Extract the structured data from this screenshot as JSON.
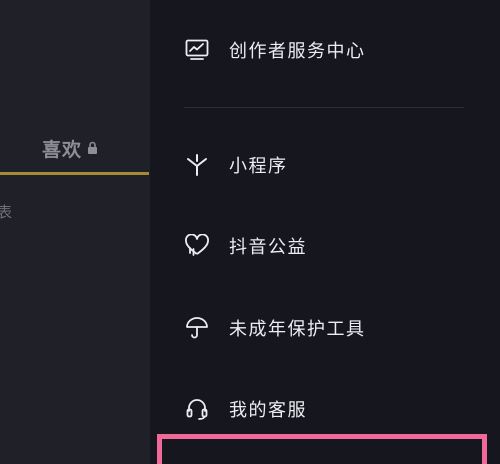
{
  "left_panel": {
    "likes_tab_label": "喜欢",
    "fragment_text": "表"
  },
  "drawer": {
    "items": [
      {
        "label": "创作者服务中心",
        "icon": "creator-chart-icon"
      },
      {
        "label": "小程序",
        "icon": "mini-program-icon"
      },
      {
        "label": "抖音公益",
        "icon": "charity-heart-icon"
      },
      {
        "label": "未成年保护工具",
        "icon": "umbrella-icon"
      },
      {
        "label": "我的客服",
        "icon": "headset-icon"
      }
    ]
  },
  "colors": {
    "background": "#16161e",
    "left_panel": "#1f2028",
    "accent_underline": "#a58b36",
    "highlight": "#f06a99",
    "text": "#ecedf0"
  }
}
